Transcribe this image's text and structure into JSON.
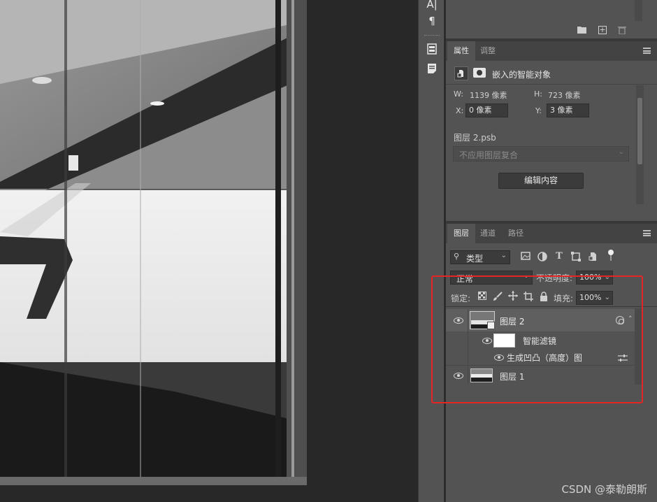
{
  "toolstrip": {
    "icons": [
      "character-panel-icon",
      "paragraph-icon",
      "properties-icon",
      "notes-icon"
    ],
    "paragraph_glyph": "¶",
    "char_glyph": "A|"
  },
  "properties": {
    "tabs": [
      "属性",
      "调整"
    ],
    "header": "嵌入的智能对象",
    "w_label": "W:",
    "w_value": "1139 像素",
    "h_label": "H:",
    "h_value": "723 像素",
    "x_label": "X:",
    "x_value": "0 像素",
    "y_label": "Y:",
    "y_value": "3 像素",
    "filename": "图层 2.psb",
    "comp_placeholder": "不应用图层复合",
    "edit_button": "编辑内容"
  },
  "layers": {
    "tabs": [
      "图层",
      "通道",
      "路径"
    ],
    "filter_label": "类型",
    "blend_mode": "正常",
    "opacity_label": "不透明度:",
    "opacity_value": "100%",
    "lock_label": "锁定:",
    "fill_label": "填充:",
    "fill_value": "100%",
    "rows": [
      {
        "name": "图层 2"
      },
      {
        "name": "智能滤镜"
      },
      {
        "name": "生成凹凸（高度）图"
      },
      {
        "name": "图层 1"
      }
    ]
  },
  "watermark": "CSDN @泰勒朗斯",
  "colors": {
    "panel_bg": "#535353",
    "tabbar_bg": "#434343",
    "highlight_box": "#e52424",
    "selected_row": "#5f5f5f"
  }
}
